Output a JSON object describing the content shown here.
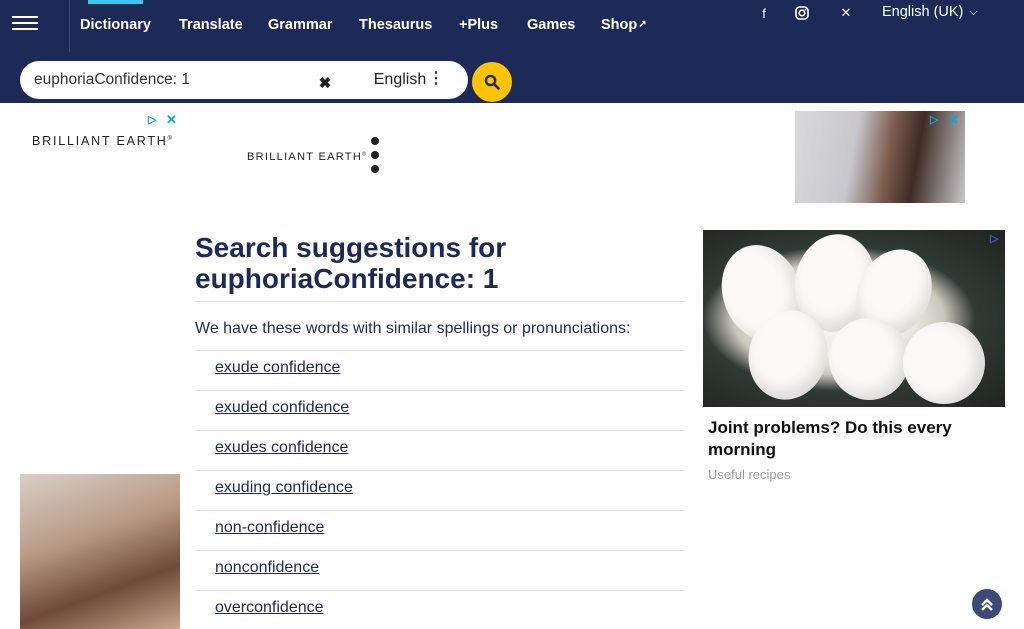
{
  "nav": {
    "links": [
      {
        "label": "Dictionary",
        "active": true
      },
      {
        "label": "Translate"
      },
      {
        "label": "Grammar"
      },
      {
        "label": "Thesaurus"
      },
      {
        "label": "+Plus"
      },
      {
        "label": "Games"
      },
      {
        "label": "Shop",
        "external": true
      }
    ],
    "social_icons": [
      "facebook-icon",
      "instagram-icon",
      "x-twitter-icon"
    ],
    "ui_language": "English (UK)"
  },
  "search": {
    "value": "euphoriaConfidence: 1",
    "language": "English",
    "clear_icon": "close-icon",
    "submit_icon": "search-icon"
  },
  "ads": {
    "left_brand": "BRILLIANT EARTH",
    "banner_brand": "BRILLIANT EARTH",
    "right_headline": "Joint problems? Do this every morning",
    "right_sponsor": "Useful recipes"
  },
  "results": {
    "heading": "Search suggestions for",
    "query": "euphoriaConfidence: 1",
    "intro": "We have these words with similar spellings or pronunciations:",
    "suggestions": [
      "exude confidence",
      "exuded confidence",
      "exudes confidence",
      "exuding confidence",
      "non-confidence",
      "nonconfidence",
      "overconfidence"
    ]
  },
  "colors": {
    "brand_navy": "#1d2a57",
    "accent_yellow": "#fec400",
    "active_tab": "#3fc6ec"
  }
}
